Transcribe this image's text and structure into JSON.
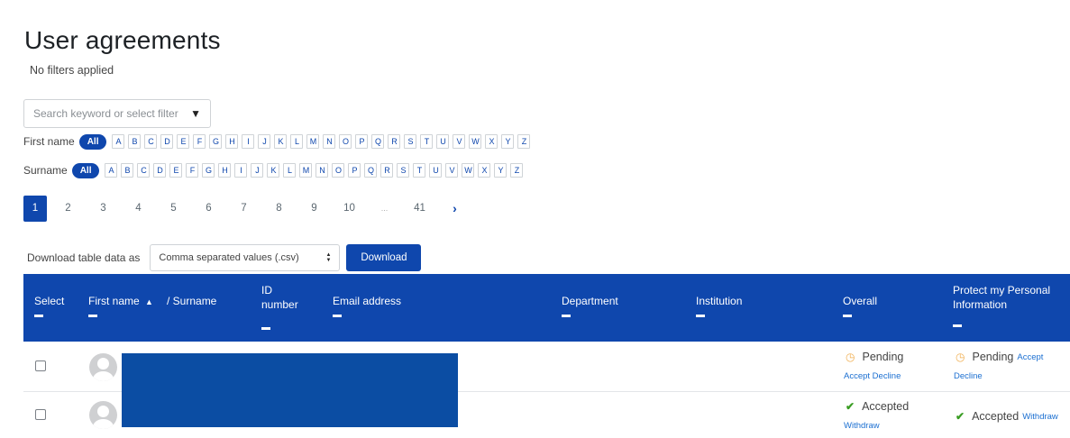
{
  "page": {
    "title": "User agreements",
    "filter_status": "No filters applied",
    "search_placeholder": "Search keyword or select filter",
    "dropdown_icon": "triangle-down"
  },
  "initials": {
    "first_label": "First name",
    "surname_label": "Surname",
    "all_label": "All",
    "letters": [
      "A",
      "B",
      "C",
      "D",
      "E",
      "F",
      "G",
      "H",
      "I",
      "J",
      "K",
      "L",
      "M",
      "N",
      "O",
      "P",
      "Q",
      "R",
      "S",
      "T",
      "U",
      "V",
      "W",
      "X",
      "Y",
      "Z"
    ]
  },
  "pagination": {
    "pages": [
      "1",
      "2",
      "3",
      "4",
      "5",
      "6",
      "7",
      "8",
      "9",
      "10",
      "...",
      "41"
    ],
    "current": "1",
    "next_icon": "chevron-right"
  },
  "download": {
    "label": "Download table data as",
    "selected": "Comma separated values (.csv)",
    "button": "Download"
  },
  "table": {
    "columns": {
      "select": "Select",
      "first_name": "First name",
      "surname": "/ Surname",
      "id_number": "ID\nnumber",
      "email": "Email address",
      "department": "Department",
      "institution": "Institution",
      "overall": "Overall",
      "policy": "Protect my Personal Information"
    },
    "rows": [
      {
        "overall_status": "Pending",
        "overall_links": "Accept Decline",
        "policy_status": "Pending",
        "policy_link_accept": "Accept",
        "policy_link_decline": "Decline"
      },
      {
        "overall_status": "Accepted",
        "overall_links": "Withdraw",
        "policy_status": "Accepted",
        "policy_link": "Withdraw"
      }
    ]
  },
  "colors": {
    "primary": "#0f47ad",
    "pending": "#f0ad4e",
    "accepted": "#3a9d23",
    "link": "#1b6fd1"
  }
}
